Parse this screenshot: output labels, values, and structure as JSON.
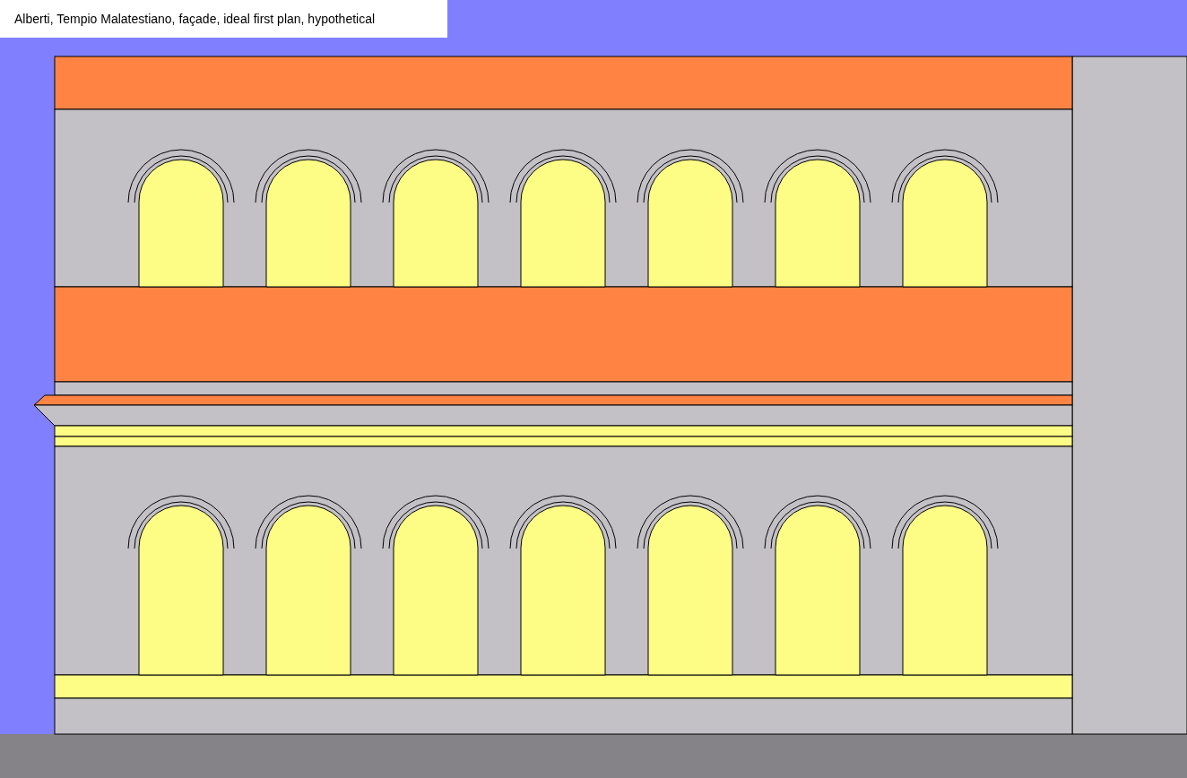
{
  "title": "Alberti, Tempio Malatestiano, façade, ideal first plan, hypothetical"
}
